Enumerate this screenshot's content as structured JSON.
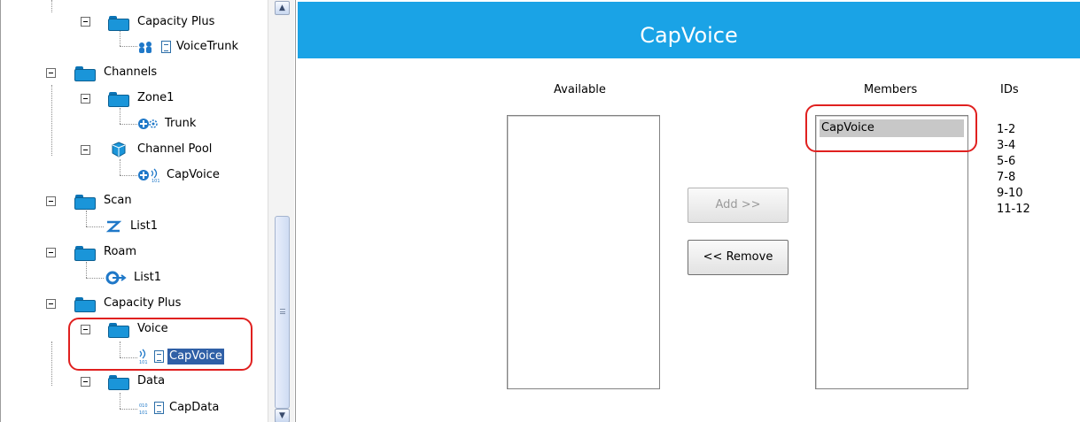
{
  "tree": {
    "items": [
      {
        "label": "Capacity Plus",
        "icon": "folder-icon"
      },
      {
        "label": "VoiceTrunk",
        "icon": "voice-trunk-icon"
      },
      {
        "label": "Channels",
        "icon": "folder-icon"
      },
      {
        "label": "Zone1",
        "icon": "folder-icon"
      },
      {
        "label": "Trunk",
        "icon": "trunk-icon"
      },
      {
        "label": "Channel Pool",
        "icon": "channel-pool-icon"
      },
      {
        "label": "CapVoice",
        "icon": "voice-channel-icon"
      },
      {
        "label": "Scan",
        "icon": "folder-icon"
      },
      {
        "label": "List1",
        "icon": "scan-list-icon"
      },
      {
        "label": "Roam",
        "icon": "folder-icon"
      },
      {
        "label": "List1",
        "icon": "roam-list-icon"
      },
      {
        "label": "Capacity Plus",
        "icon": "folder-icon"
      },
      {
        "label": "Voice",
        "icon": "folder-icon"
      },
      {
        "label": "CapVoice",
        "icon": "voice-document-icon",
        "selected": true
      },
      {
        "label": "Data",
        "icon": "folder-icon"
      },
      {
        "label": "CapData",
        "icon": "data-document-icon"
      }
    ]
  },
  "panel": {
    "title": "CapVoice",
    "available_label": "Available",
    "members_label": "Members",
    "ids_label": "IDs",
    "add_button": "Add >>",
    "remove_button": "<< Remove",
    "members": [
      "CapVoice"
    ],
    "ids": [
      "1-2",
      "3-4",
      "5-6",
      "7-8",
      "9-10",
      "11-12"
    ]
  },
  "colors": {
    "header_bg": "#1aa3e6",
    "selection_bg": "#2f5fa6",
    "highlight": "#e0201f",
    "folder": "#1a95d9"
  }
}
